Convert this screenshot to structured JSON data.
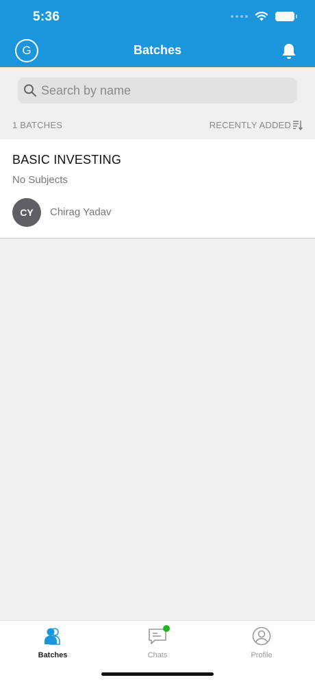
{
  "status_bar": {
    "time": "5:36"
  },
  "header": {
    "avatar_letter": "G",
    "title": "Batches"
  },
  "search": {
    "placeholder": "Search by name"
  },
  "list_meta": {
    "count_label": "1 BATCHES",
    "sort_label": "RECENTLY ADDED"
  },
  "batches": [
    {
      "title": "BASIC INVESTING",
      "subjects": "No Subjects",
      "owner_initials": "CY",
      "owner_name": "Chirag Yadav"
    }
  ],
  "tabbar": {
    "tabs": [
      {
        "label": "Batches",
        "icon": "batches-icon",
        "active": true
      },
      {
        "label": "Chats",
        "icon": "chat-icon",
        "badge": true
      },
      {
        "label": "Profile",
        "icon": "profile-icon"
      }
    ]
  },
  "colors": {
    "primary": "#1b96dc",
    "badge": "#1fb51f",
    "avatar_bg": "#5f6066"
  }
}
